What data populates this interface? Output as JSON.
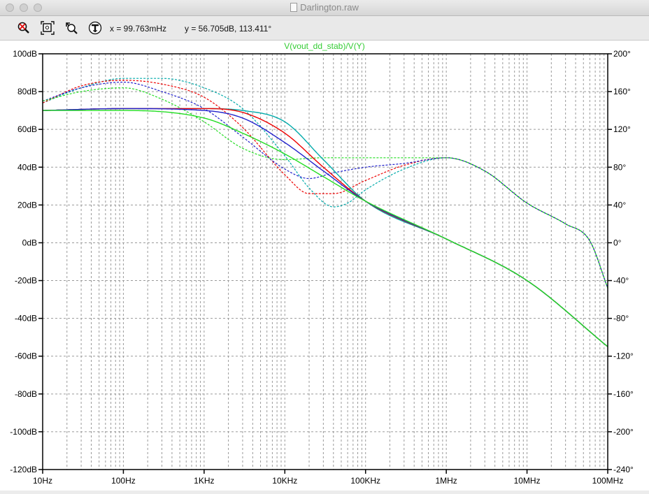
{
  "window": {
    "title": "Darlington.raw"
  },
  "toolbar": {
    "cursor_x": "x = 99.763mHz",
    "cursor_y": "y = 56.705dB, 113.411°",
    "icons": [
      "zoom-cancel-icon",
      "zoom-full-icon",
      "zoom-back-icon",
      "probe-icon"
    ]
  },
  "chart_data": {
    "type": "line",
    "title": "V(vout_dd_stab)/V(Y)",
    "x_scale": "log",
    "x_range_hz": [
      10,
      100000000
    ],
    "x_tick_values": [
      10,
      100,
      1000,
      10000,
      100000,
      1000000,
      10000000,
      100000000
    ],
    "x_tick_labels": [
      "10Hz",
      "100Hz",
      "1KHz",
      "10KHz",
      "100KHz",
      "1MHz",
      "10MHz",
      "100MHz"
    ],
    "y_left": {
      "unit": "dB",
      "range": [
        -120,
        100
      ],
      "tick_labels": [
        "100dB",
        "80dB",
        "60dB",
        "40dB",
        "20dB",
        "0dB",
        "-20dB",
        "-40dB",
        "-60dB",
        "-80dB",
        "-100dB",
        "-120dB"
      ]
    },
    "y_right": {
      "unit": "degrees",
      "range": [
        -240,
        200
      ],
      "tick_labels": [
        "200°",
        "160°",
        "120°",
        "80°",
        "40°",
        "0°",
        "-40°",
        "-80°",
        "-120°",
        "-160°",
        "-200°",
        "-240°"
      ]
    },
    "grid": true,
    "colors": {
      "title": "#33cc33",
      "axis": "#000000",
      "grid": "#9a9a9a",
      "background": "#ffffff"
    },
    "series": [
      {
        "color": "#00aaaa",
        "magnitude_db": [
          [
            10,
            70
          ],
          [
            100,
            71
          ],
          [
            1000,
            71
          ],
          [
            3000,
            70
          ],
          [
            10000,
            64
          ],
          [
            30000,
            44
          ],
          [
            100000,
            22
          ],
          [
            1000000,
            2
          ],
          [
            10000000,
            -20
          ],
          [
            100000000,
            -55
          ]
        ],
        "phase_deg": [
          [
            10,
            148
          ],
          [
            30,
            164
          ],
          [
            100,
            174
          ],
          [
            300,
            174
          ],
          [
            1000,
            164
          ],
          [
            3000,
            142
          ],
          [
            10000,
            92
          ],
          [
            20000,
            58
          ],
          [
            40000,
            38
          ],
          [
            60000,
            42
          ],
          [
            100000,
            56
          ],
          [
            300000,
            78
          ],
          [
            1000000,
            90
          ],
          [
            3000000,
            76
          ],
          [
            10000000,
            42
          ],
          [
            30000000,
            20
          ],
          [
            60000000,
            2
          ],
          [
            100000000,
            -48
          ]
        ]
      },
      {
        "color": "#ee0000",
        "magnitude_db": [
          [
            10,
            70
          ],
          [
            100,
            71
          ],
          [
            1000,
            71
          ],
          [
            3000,
            69
          ],
          [
            10000,
            58
          ],
          [
            30000,
            40
          ],
          [
            100000,
            22
          ],
          [
            1000000,
            2
          ],
          [
            10000000,
            -20
          ],
          [
            100000000,
            -55
          ]
        ],
        "phase_deg": [
          [
            10,
            148
          ],
          [
            30,
            166
          ],
          [
            100,
            172
          ],
          [
            300,
            168
          ],
          [
            1000,
            154
          ],
          [
            3000,
            122
          ],
          [
            10000,
            72
          ],
          [
            20000,
            52
          ],
          [
            40000,
            52
          ],
          [
            100000,
            66
          ],
          [
            300000,
            82
          ],
          [
            1000000,
            90
          ],
          [
            3000000,
            76
          ],
          [
            10000000,
            42
          ],
          [
            30000000,
            20
          ],
          [
            60000000,
            2
          ],
          [
            100000000,
            -48
          ]
        ]
      },
      {
        "color": "#2222cc",
        "magnitude_db": [
          [
            10,
            70
          ],
          [
            100,
            71
          ],
          [
            1000,
            70
          ],
          [
            3000,
            66
          ],
          [
            10000,
            53
          ],
          [
            30000,
            38
          ],
          [
            100000,
            22
          ],
          [
            1000000,
            2
          ],
          [
            10000000,
            -20
          ],
          [
            100000000,
            -55
          ]
        ],
        "phase_deg": [
          [
            10,
            150
          ],
          [
            30,
            164
          ],
          [
            100,
            170
          ],
          [
            300,
            160
          ],
          [
            1000,
            142
          ],
          [
            3000,
            112
          ],
          [
            10000,
            78
          ],
          [
            20000,
            68
          ],
          [
            40000,
            74
          ],
          [
            100000,
            80
          ],
          [
            300000,
            84
          ],
          [
            1000000,
            90
          ],
          [
            3000000,
            76
          ],
          [
            10000000,
            42
          ],
          [
            30000000,
            20
          ],
          [
            60000000,
            2
          ],
          [
            100000000,
            -48
          ]
        ]
      },
      {
        "color": "#22dd22",
        "magnitude_db": [
          [
            10,
            70
          ],
          [
            100,
            70
          ],
          [
            1000,
            66
          ],
          [
            3000,
            58
          ],
          [
            10000,
            47
          ],
          [
            30000,
            35
          ],
          [
            100000,
            22
          ],
          [
            1000000,
            2
          ],
          [
            10000000,
            -20
          ],
          [
            100000000,
            -55
          ]
        ],
        "phase_deg": [
          [
            10,
            150
          ],
          [
            30,
            160
          ],
          [
            100,
            164
          ],
          [
            300,
            152
          ],
          [
            1000,
            128
          ],
          [
            3000,
            100
          ],
          [
            10000,
            88
          ],
          [
            30000,
            90
          ],
          [
            100000,
            90
          ],
          [
            300000,
            90
          ],
          [
            1000000,
            90
          ],
          [
            3000000,
            76
          ],
          [
            10000000,
            42
          ],
          [
            30000000,
            20
          ],
          [
            60000000,
            2
          ],
          [
            100000000,
            -48
          ]
        ]
      }
    ]
  }
}
